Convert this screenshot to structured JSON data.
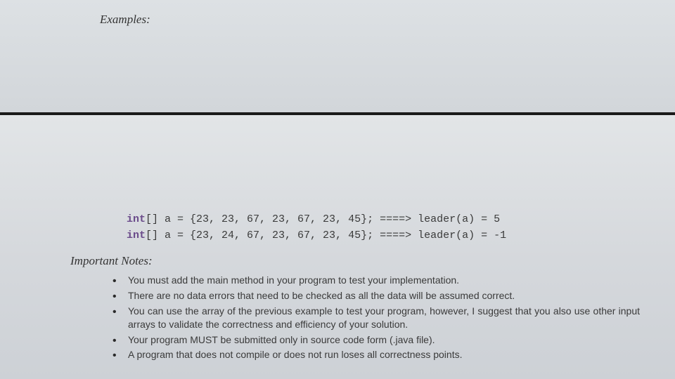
{
  "top": {
    "heading": "Examples:"
  },
  "code": {
    "line1_keyword": "int",
    "line1_rest": "[] a = {23, 23, 67, 23, 67, 23, 45}; ====> leader(a) = 5",
    "line2_keyword": "int",
    "line2_rest": "[] a = {23, 24, 67, 23, 67, 23, 45}; ====> leader(a) = -1"
  },
  "notes": {
    "heading": "Important Notes:",
    "items": [
      "You must add the main method in your program to test your implementation.",
      "There are no data errors that need to be checked as all the data will be assumed correct.",
      "You can use the array of the previous example to test your program, however, I suggest that you also use other input arrays to validate the correctness and efficiency of your solution.",
      "Your program MUST be submitted only in source code form (.java file).",
      "A program that does not compile or does not run loses all correctness points."
    ]
  }
}
